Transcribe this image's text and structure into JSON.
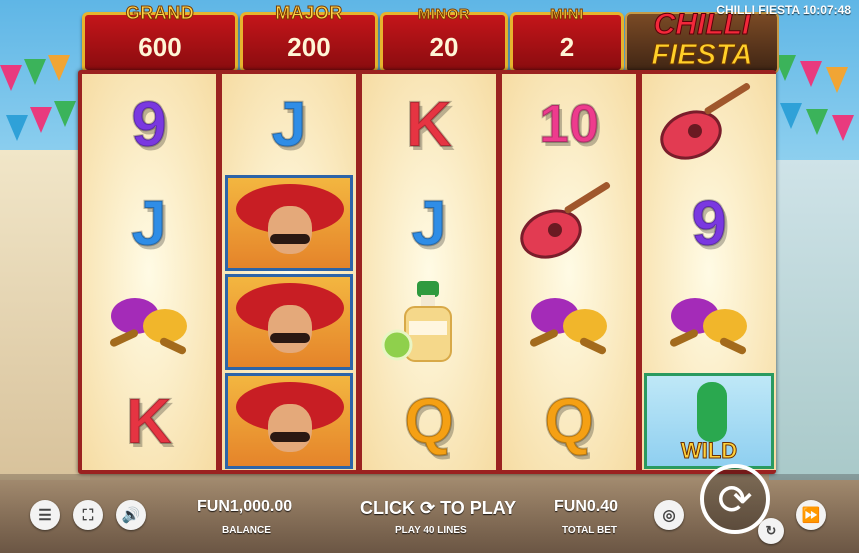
{
  "clock": "CHILLI FIESTA 10:07:48",
  "logo": {
    "line1": "CHILLI",
    "line2": "FIESTA"
  },
  "jackpots": [
    {
      "label": "GRAND",
      "value": "600"
    },
    {
      "label": "MAJOR",
      "value": "200"
    },
    {
      "label": "MINOR",
      "value": "20"
    },
    {
      "label": "MINI",
      "value": "2"
    }
  ],
  "reels": {
    "r1": [
      "9",
      "J",
      "maracas",
      "K"
    ],
    "r2": [
      "J",
      "mariachi",
      "mariachi",
      "mariachi"
    ],
    "r3": [
      "K",
      "J",
      "tequila",
      "Q"
    ],
    "r4": [
      "10",
      "guitar",
      "maracas",
      "Q"
    ],
    "r5": [
      "guitar",
      "9",
      "maracas",
      "WILD"
    ]
  },
  "balance": {
    "value": "FUN1,000.00",
    "label": "BALANCE"
  },
  "play": {
    "value": "CLICK ⟳ TO PLAY",
    "label": "PLAY 40 LINES"
  },
  "bet": {
    "value": "FUN0.40",
    "label": "TOTAL BET"
  },
  "icons": {
    "menu": "menu-icon",
    "fullscreen": "fullscreen-icon",
    "sound": "sound-icon",
    "coins": "coins-icon",
    "spin": "spin-icon",
    "autoplay": "autoplay-icon",
    "turbo": "fast-forward-icon"
  },
  "colors": {
    "reel_frame": "#9b2220",
    "jackpot_red": "#c4151a",
    "jackpot_gold": "#e6b32e"
  }
}
